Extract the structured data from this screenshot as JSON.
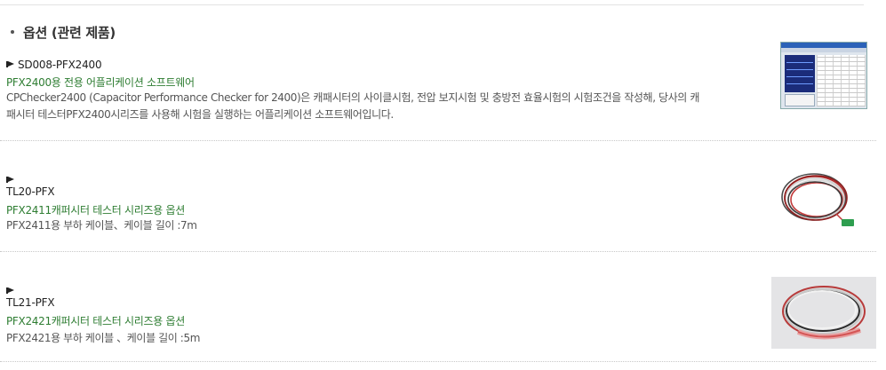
{
  "section": {
    "title": "옵션 (관련 제품)"
  },
  "items": [
    {
      "model": "SD008-PFX2400",
      "subtitle": "PFX2400용 전용 어플리케이션 소프트웨어",
      "desc_line1": "CPChecker2400 (Capacitor Performance Checker for 2400)은 캐패시터의 사이클시험, 전압 보지시험 및 충방전 효율시험의 시험조건을 작성해, 당사의 캐",
      "desc_line2": "패시터 테스터PFX2400시리즈를 사용해 시험을 실행하는 어플리케이션 소프트웨어입니다.",
      "image": "software-screenshot"
    },
    {
      "model": "TL20-PFX",
      "subtitle": "PFX2411캐퍼시터 테스터 시리즈용 옵션",
      "desc_line1": "PFX2411용 부하 케이블、케이블 길이 :7m",
      "image": "cable-coil-red-white"
    },
    {
      "model": "TL21-PFX",
      "subtitle": "PFX2421캐퍼시터 테스터 시리즈용 옵션",
      "desc_line1": "PFX2421용 부하 케이블 、케이블 길이 :5m",
      "image": "cable-coil-large"
    }
  ],
  "colors": {
    "subtitle": "#2e7d32",
    "text": "#555555",
    "separator": "#c8c8c8"
  }
}
